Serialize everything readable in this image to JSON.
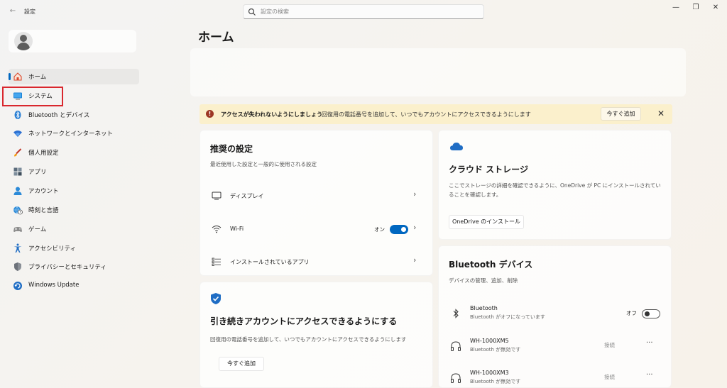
{
  "window": {
    "app_title": "設定",
    "back_label": "←",
    "minimize_label": "—",
    "maximize_label": "❐",
    "close_label": "✕"
  },
  "search": {
    "placeholder": "設定の検索",
    "value": ""
  },
  "sidebar": {
    "items": [
      {
        "label": "ホーム",
        "icon": "home-icon",
        "active": true
      },
      {
        "label": "システム",
        "icon": "system-icon",
        "highlighted": true
      },
      {
        "label": "Bluetooth とデバイス",
        "icon": "bluetooth-icon"
      },
      {
        "label": "ネットワークとインターネット",
        "icon": "wifi-icon"
      },
      {
        "label": "個人用設定",
        "icon": "brush-icon"
      },
      {
        "label": "アプリ",
        "icon": "apps-icon"
      },
      {
        "label": "アカウント",
        "icon": "account-icon"
      },
      {
        "label": "時刻と言語",
        "icon": "globe-clock-icon"
      },
      {
        "label": "ゲーム",
        "icon": "gamepad-icon"
      },
      {
        "label": "アクセシビリティ",
        "icon": "accessibility-icon"
      },
      {
        "label": "プライバシーとセキュリティ",
        "icon": "shield-icon"
      },
      {
        "label": "Windows Update",
        "icon": "update-icon"
      }
    ]
  },
  "main": {
    "title": "ホーム",
    "alert": {
      "title": "アクセスが失われないようにしましょう",
      "message": "回復用の電話番号を追加して、いつでもアカウントにアクセスできるようにします",
      "button": "今すぐ追加",
      "close": "✕",
      "icon": "!"
    },
    "recommended": {
      "title": "推奨の設定",
      "subtitle": "最近使用した設定と一般的に使用される設定",
      "items": [
        {
          "label": "ディスプレイ",
          "icon": "display-icon"
        },
        {
          "label": "Wi-Fi",
          "icon": "wifi-icon",
          "toggle_state": "オン"
        },
        {
          "label": "インストールされているアプリ",
          "icon": "apps-list-icon"
        }
      ],
      "chevron": "›"
    },
    "account_card": {
      "title": "引き続きアカウントにアクセスできるようにする",
      "subtitle": "回復用の電話番号を追加して、いつでもアカウントにアクセスできるようにします",
      "button": "今すぐ追加"
    },
    "cloud": {
      "title": "クラウド ストレージ",
      "description_line1": "ここでストレージの詳細を確認できるように、OneDrive が PC にインストールされてい",
      "description_line2": "ることを確認します。",
      "button": "OneDrive のインストール"
    },
    "bluetooth": {
      "title": "Bluetooth デバイス",
      "subtitle": "デバイスの管理、追加、削除",
      "toggle": {
        "name": "Bluetooth",
        "status": "Bluetooth がオフになっています",
        "state": "オフ"
      },
      "devices": [
        {
          "name": "WH-1000XM5",
          "status": "Bluetooth が無効です",
          "action": "接続",
          "more": "···"
        },
        {
          "name": "WH-1000XM3",
          "status": "Bluetooth が無効です",
          "action": "接続",
          "more": "···"
        }
      ]
    }
  },
  "colors": {
    "accent": "#0067c0",
    "alert_bg": "#fbf0cc",
    "highlight_border": "#d9272e"
  }
}
